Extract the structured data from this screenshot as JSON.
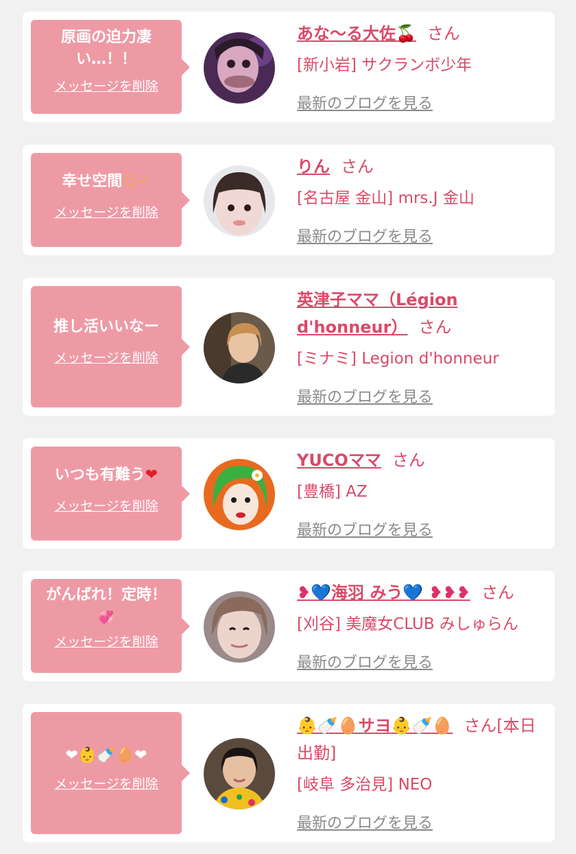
{
  "colors": {
    "page_background": "#f1f1f1",
    "card_background": "#ffffff",
    "bubble_pink": "#ee9aa5",
    "accent_text": "#d94a68",
    "link_gray": "#8a8a8a"
  },
  "entries": [
    {
      "message": "原画の迫力凄い…！！",
      "delete_label": "メッセージを削除",
      "name_text": "あな〜る大佐",
      "name_suffix_icon": "cherry-icon",
      "name_suffix_glyph": "🍒",
      "san": "さん",
      "shop": "[新小岩] サクランボ少年",
      "blog_link": "最新のブログを見る"
    },
    {
      "message_text": "幸せ空間",
      "message_icons": [
        "smile-icon",
        "sparkle-icon"
      ],
      "message_glyphs": "😊✨",
      "delete_label": "メッセージを削除",
      "name_text": "りん",
      "san": "さん",
      "shop": "[名古屋 金山] mrs.J 金山",
      "blog_link": "最新のブログを見る"
    },
    {
      "message": "推し活いいなー",
      "delete_label": "メッセージを削除",
      "name_text": "英津子ママ（Légion d'honneur）",
      "san": "さん",
      "shop": "[ミナミ] Legion d'honneur",
      "blog_link": "最新のブログを見る"
    },
    {
      "message_text": "いつも有難う",
      "message_icons": [
        "heart-icon"
      ],
      "message_glyphs": "❤",
      "delete_label": "メッセージを削除",
      "name_text": "YUCOママ",
      "san": "さん",
      "shop": "[豊橋] AZ",
      "blog_link": "最新のブログを見る"
    },
    {
      "message_text": "がんばれ！定時！",
      "message_icons": [
        "pink-hearts-icon"
      ],
      "message_glyphs": "💞",
      "delete_label": "メッセージを削除",
      "name_prefix_icons": [
        "pink-heart-icon",
        "blue-heart-icon"
      ],
      "name_prefix_glyphs_pink": "❥",
      "name_prefix_glyphs_blue": "💙",
      "name_text": "海羽 みう",
      "name_suffix_icons": [
        "blue-heart-icon",
        "pink-hearts-icon"
      ],
      "name_suffix_glyphs_blue": "💙",
      "name_suffix_glyphs_pink": "❥❥❥",
      "san": "さん",
      "shop": "[刈谷] 美魔女CLUB みしゅらん",
      "blog_link": "最新のブログを見る"
    },
    {
      "message_icons": [
        "heart-icon",
        "baby-icon",
        "bottle-icon",
        "egg-icon",
        "heart-icon"
      ],
      "message_glyphs": "❤👶🍼🥚❤",
      "delete_label": "メッセージを削除",
      "name_prefix_icons": [
        "baby-icon",
        "bottle-icon",
        "egg-icon"
      ],
      "name_prefix_glyphs": "👶🍼🥚",
      "name_text": "サヨ",
      "name_suffix_icons": [
        "baby-icon",
        "bottle-icon",
        "egg-icon"
      ],
      "name_suffix_glyphs": "👶🍼🥚",
      "san": "さん[本日出勤]",
      "shop": "[岐阜 多治見] NEO",
      "blog_link": "最新のブログを見る"
    }
  ]
}
